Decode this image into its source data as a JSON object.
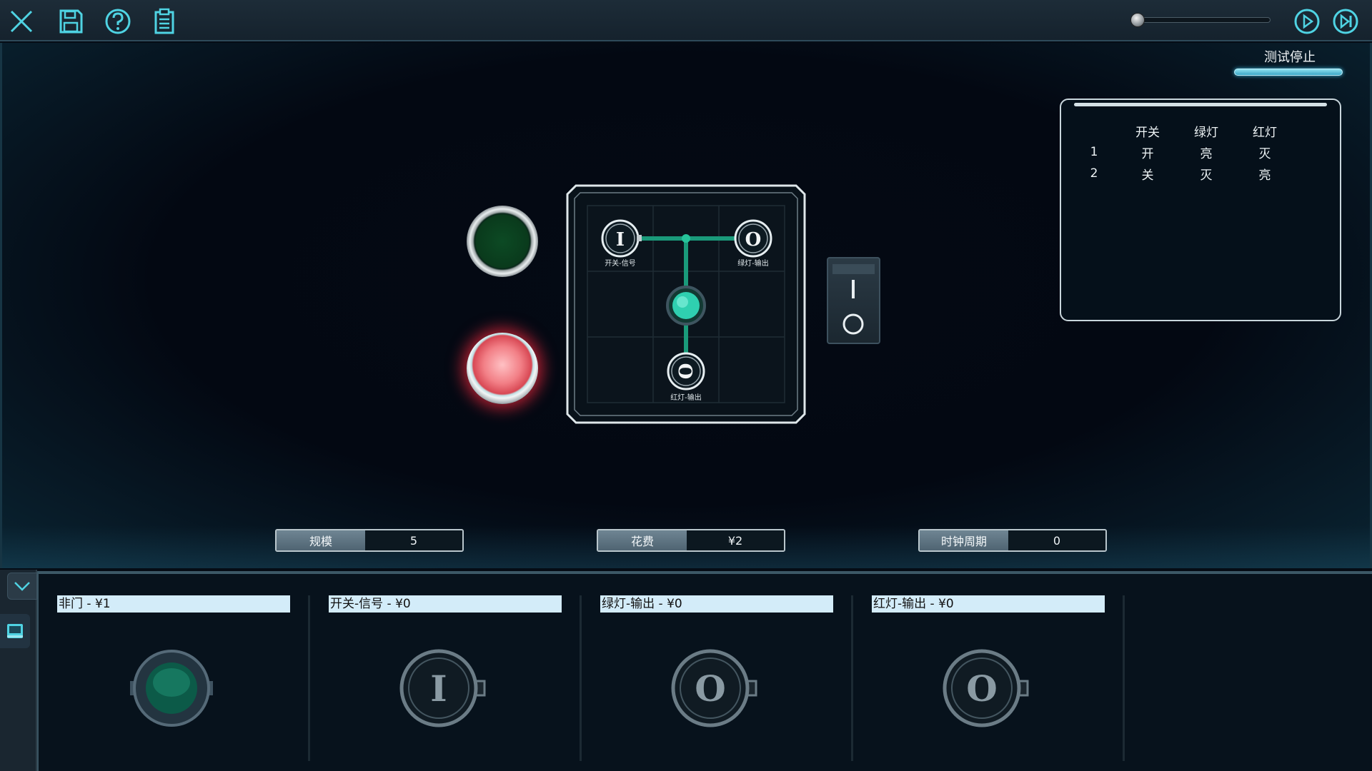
{
  "toolbar": {
    "icons": [
      "close-icon",
      "save-icon",
      "help-icon",
      "clipboard-icon",
      "play-icon",
      "step-forward-icon"
    ]
  },
  "status": {
    "test_label": "测试停止"
  },
  "truth_table": {
    "headers": [
      "",
      "开关",
      "绿灯",
      "红灯"
    ],
    "rows": [
      [
        "1",
        "开",
        "亮",
        "灭"
      ],
      [
        "2",
        "关",
        "灭",
        "亮"
      ]
    ]
  },
  "board": {
    "input_label": "开关-信号",
    "green_output_label": "绿灯-输出",
    "red_output_label": "红灯-输出",
    "input_glyph": "I",
    "output_glyph": "O"
  },
  "stats": {
    "scale_label": "规模",
    "scale_value": "5",
    "cost_label": "花费",
    "cost_value": "¥2",
    "clock_label": "时钟周期",
    "clock_value": "0"
  },
  "palette": {
    "items": [
      {
        "label": "非门 - ¥1",
        "icon": "not-gate-icon"
      },
      {
        "label": "开关-信号 - ¥0",
        "icon": "input-node-icon",
        "glyph": "I"
      },
      {
        "label": "绿灯-输出 - ¥0",
        "icon": "output-node-icon",
        "glyph": "O"
      },
      {
        "label": "红灯-输出 - ¥0",
        "icon": "output-node-icon",
        "glyph": "O"
      }
    ]
  },
  "colors": {
    "accent": "#4fd3e3",
    "wire": "#1f8f74",
    "red_lamp": "#e8505c",
    "green_lamp": "#0c4a24"
  }
}
